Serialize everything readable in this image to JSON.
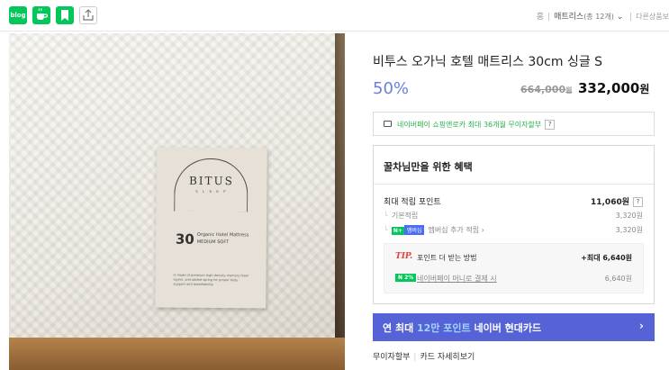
{
  "topbar": {
    "icons": [
      "blog-icon",
      "cafe-icon",
      "bookmark-icon",
      "share-icon"
    ],
    "blog_label": "blog",
    "breadcrumb": {
      "home": "홈",
      "category": "매트리스",
      "count": "(총 12개)",
      "more": "다른상품보"
    }
  },
  "product_image": {
    "brand": "BITUS",
    "brand_sub": "S L E E P",
    "number": "30",
    "line1": "Organic Hotel Mattress",
    "line2": "MEDIUM SOFT",
    "desc": "is made of premium high-density memory foam layers, and added spring for proper body support and breathability"
  },
  "product": {
    "title": "비투스 오가닉 호텔 매트리스 30cm 싱글 S",
    "discount": "50%",
    "original_price": "664,000",
    "original_unit": "원",
    "sale_price": "332,000",
    "sale_unit": "원"
  },
  "npay": {
    "text": "네이버페이 쇼핑앤로카 최대 36개월 무이자할부",
    "help": "?"
  },
  "benefit": {
    "title": "꿀차님만을 위한 혜택",
    "max_points_label": "최대 적립 포인트",
    "max_points_value": "11,060원",
    "help": "?",
    "basic_label": "기본적립",
    "basic_value": "3,320원",
    "membership_badge_n": "N+",
    "membership_badge": "멤버십",
    "membership_label": "멤버십 추가 적립",
    "membership_value": "3,320원",
    "tip_label": "TIP.",
    "tip_text": "포인트 더 받는 방법",
    "tip_value": "+최대 6,640원",
    "tip_badge": "N 2%",
    "tip_link": "네이버페이 머니로 결제 시",
    "tip_link_value": "6,640원"
  },
  "card_banner": {
    "prefix": "연 최대 ",
    "highlight": "12만 포인트",
    "suffix": " 네이버 현대카드",
    "chevron": "›"
  },
  "links": {
    "installment": "무이자할부",
    "card_detail": "카드 자세히보기"
  },
  "colors": {
    "naver_green": "#03c75a",
    "discount_blue": "#6c7fe0",
    "banner_blue": "#5663d6",
    "tip_red": "#e4413b"
  }
}
